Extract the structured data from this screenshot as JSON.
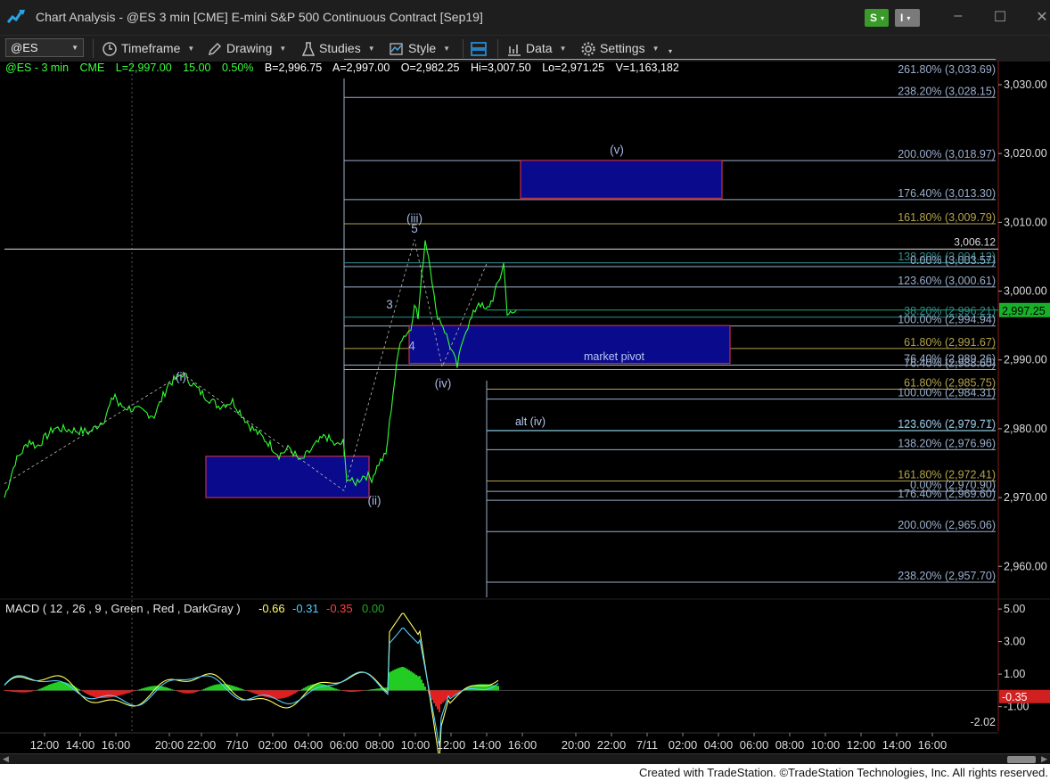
{
  "window": {
    "title": "Chart Analysis - @ES 3 min [CME] E-mini S&P 500 Continuous Contract [Sep19]",
    "s_button": "S",
    "i_button": "I",
    "s_color": "#3a9a2a",
    "i_color": "#7a7a7a"
  },
  "toolbar": {
    "symbol": "@ES",
    "timeframe": "Timeframe",
    "drawing": "Drawing",
    "studies": "Studies",
    "style": "Style",
    "data": "Data",
    "settings": "Settings"
  },
  "quote": {
    "symbol": "@ES - 3 min",
    "exchange": "CME",
    "last": "L=2,997.00",
    "change": "15.00",
    "pct": "0.50%",
    "bid": "B=2,996.75",
    "ask": "A=2,997.00",
    "open": "O=2,982.25",
    "high": "Hi=3,007.50",
    "low": "Lo=2,971.25",
    "volume": "V=1,163,182"
  },
  "chart_data": [
    {
      "type": "line",
      "title": "@ES 3 min",
      "y_axis": {
        "ticks": [
          "3,030.00",
          "3,020.00",
          "3,010.00",
          "3,000.00",
          "2,990.00",
          "2,980.00",
          "2,970.00",
          "2,960.00"
        ],
        "ylim": [
          2955.5,
          3033.5
        ]
      },
      "x_ticks": [
        "12:00",
        "14:00",
        "16:00",
        "20:00",
        "22:00",
        "7/10",
        "02:00",
        "04:00",
        "06:00",
        "08:00",
        "10:00",
        "12:00",
        "14:00",
        "16:00",
        "20:00",
        "22:00",
        "7/11",
        "02:00",
        "04:00",
        "06:00",
        "08:00",
        "10:00",
        "12:00",
        "14:00",
        "16:00"
      ],
      "price_path": [
        [
          0,
          2970.0
        ],
        [
          0.15,
          2975.2
        ],
        [
          0.35,
          2978.3
        ],
        [
          0.45,
          2977.4
        ],
        [
          0.7,
          2980.1
        ],
        [
          1.2,
          2979.5
        ],
        [
          1.4,
          2981.4
        ],
        [
          1.55,
          2985.1
        ],
        [
          1.6,
          2983.4
        ],
        [
          1.9,
          2982.6
        ],
        [
          2.1,
          2981.9
        ],
        [
          2.3,
          2986.5
        ],
        [
          2.5,
          2988.0
        ],
        [
          2.75,
          2985.3
        ],
        [
          3.0,
          2983.3
        ],
        [
          3.2,
          2984.0
        ],
        [
          3.45,
          2980.3
        ],
        [
          3.7,
          2978.0
        ],
        [
          3.85,
          2976.2
        ],
        [
          4.0,
          2977.2
        ],
        [
          4.15,
          2975.2
        ],
        [
          4.35,
          2977.5
        ],
        [
          4.5,
          2979.0
        ],
        [
          4.65,
          2977.5
        ],
        [
          4.75,
          2978.0
        ],
        [
          4.8,
          2973.0
        ],
        [
          4.9,
          2972.0
        ],
        [
          5.05,
          2973.3
        ],
        [
          5.15,
          2972.8
        ],
        [
          5.25,
          2975.0
        ],
        [
          5.35,
          2976.2
        ],
        [
          5.45,
          2985.3
        ],
        [
          5.55,
          2993.0
        ],
        [
          5.7,
          2994.5
        ],
        [
          5.75,
          2998.5
        ],
        [
          5.8,
          2996.0
        ],
        [
          5.85,
          3002.0
        ],
        [
          5.9,
          3007.5
        ],
        [
          5.97,
          3004.0
        ],
        [
          6.05,
          2997.0
        ],
        [
          6.15,
          2995.0
        ],
        [
          6.25,
          2992.0
        ],
        [
          6.35,
          2989.0
        ],
        [
          6.45,
          2994.0
        ],
        [
          6.55,
          2996.0
        ],
        [
          6.65,
          2998.5
        ],
        [
          6.75,
          2997.0
        ],
        [
          6.85,
          2999.0
        ],
        [
          6.95,
          3002.0
        ],
        [
          7.0,
          3004.0
        ],
        [
          7.05,
          2997.0
        ],
        [
          7.12,
          2996.5
        ],
        [
          7.18,
          2997.25
        ]
      ],
      "last_price": "2,997.25",
      "reference_price": "3,006.12",
      "fib_levels_upper": [
        {
          "label": "238.20% (3,028.15)",
          "value": 3028.15,
          "color": "#9aaecb"
        },
        {
          "label": "200.00% (3,018.97)",
          "value": 3018.97,
          "color": "#9aaecb"
        },
        {
          "label": "176.40% (3,013.30)",
          "value": 3013.3,
          "color": "#9aaecb"
        },
        {
          "label": "161.80% (3,009.79)",
          "value": 3009.79,
          "color": "#b3a24a"
        },
        {
          "label": "138.20% (3,004.12)",
          "value": 3004.12,
          "color": "#2f8c8c"
        },
        {
          "label": "0.00% (3,003.57)",
          "value": 3003.57,
          "color": "#9aaecb"
        },
        {
          "label": "123.60% (3,000.61)",
          "value": 3000.61,
          "color": "#9aaecb"
        },
        {
          "label": "38.20% (2,996.21)",
          "value": 2996.21,
          "color": "#2f8c8c"
        },
        {
          "label": "100.00% (2,994.94)",
          "value": 2994.94,
          "color": "#9aaecb"
        },
        {
          "label": "61.80% (2,991.67)",
          "value": 2991.67,
          "color": "#b3a24a"
        },
        {
          "label": "76.40% (2,989.26)",
          "value": 2989.26,
          "color": "#9aaecb"
        },
        {
          "label": "76.40% (2,988.60)",
          "value": 2988.6,
          "color": "#9aaecb"
        }
      ],
      "fib_levels_lower": [
        {
          "label": "61.80% (2,985.75)",
          "value": 2985.75,
          "color": "#b3a24a"
        },
        {
          "label": "100.00% (2,984.31)",
          "value": 2984.31,
          "color": "#9aaecb"
        },
        {
          "label": "123.60% (2,979.77)",
          "value": 2979.77,
          "color": "#2f8c8c"
        },
        {
          "label": "123.60% (2,979.71)",
          "value": 2979.71,
          "color": "#9aaecb"
        },
        {
          "label": "138.20% (2,976.96)",
          "value": 2976.96,
          "color": "#9aaecb"
        },
        {
          "label": "161.80% (2,972.41)",
          "value": 2972.41,
          "color": "#b3a24a"
        },
        {
          "label": "0.00% (2,970.90)",
          "value": 2970.9,
          "color": "#9aaecb"
        },
        {
          "label": "176.40% (2,969.60)",
          "value": 2969.6,
          "color": "#9aaecb"
        },
        {
          "label": "200.00% (2,965.06)",
          "value": 2965.06,
          "color": "#9aaecb"
        },
        {
          "label": "238.20% (2,957.70)",
          "value": 2957.7,
          "color": "#9aaecb"
        }
      ],
      "top_clipped_label": "261.80% (3,033.69)",
      "boxes": [
        {
          "name": "target-box-v",
          "y_top": 3019.0,
          "y_bottom": 3013.5
        },
        {
          "name": "market-pivot-box",
          "y_top": 2995.0,
          "y_bottom": 2989.5
        },
        {
          "name": "wave-ii-box",
          "y_top": 2976.0,
          "y_bottom": 2970.0
        }
      ],
      "annotations": [
        {
          "text": "(i)",
          "value": 2987.5
        },
        {
          "text": "(ii)",
          "value": 2969.5
        },
        {
          "text": "(iii)",
          "value": 3010.5
        },
        {
          "text": "5",
          "value": 3009.0
        },
        {
          "text": "3",
          "value": 2998.0
        },
        {
          "text": "4",
          "value": 2992.0
        },
        {
          "text": "(iv)",
          "value": 2986.5
        },
        {
          "text": "(v)",
          "value": 3020.5
        },
        {
          "text": "market pivot",
          "value": 2990.5
        },
        {
          "text": "alt (iv)",
          "value": 2981.0
        }
      ]
    },
    {
      "type": "line",
      "title": "MACD ( 12 , 26 , 9 , Green , Red , DarkGray )",
      "values": [
        "-0.66",
        "-0.31",
        "-0.35",
        "0.00"
      ],
      "value_colors": [
        "#ffff66",
        "#4fd0ff",
        "#ff4040",
        "#22aa22"
      ],
      "y_axis": {
        "ticks": [
          "5.00",
          "3.00",
          "1.00",
          "-1.00"
        ],
        "ylim": [
          -2.5,
          5.5
        ]
      },
      "last_value": "-0.35",
      "min_label": "-2.02"
    }
  ],
  "footer": "Created with TradeStation. ©TradeStation Technologies, Inc. All rights reserved."
}
